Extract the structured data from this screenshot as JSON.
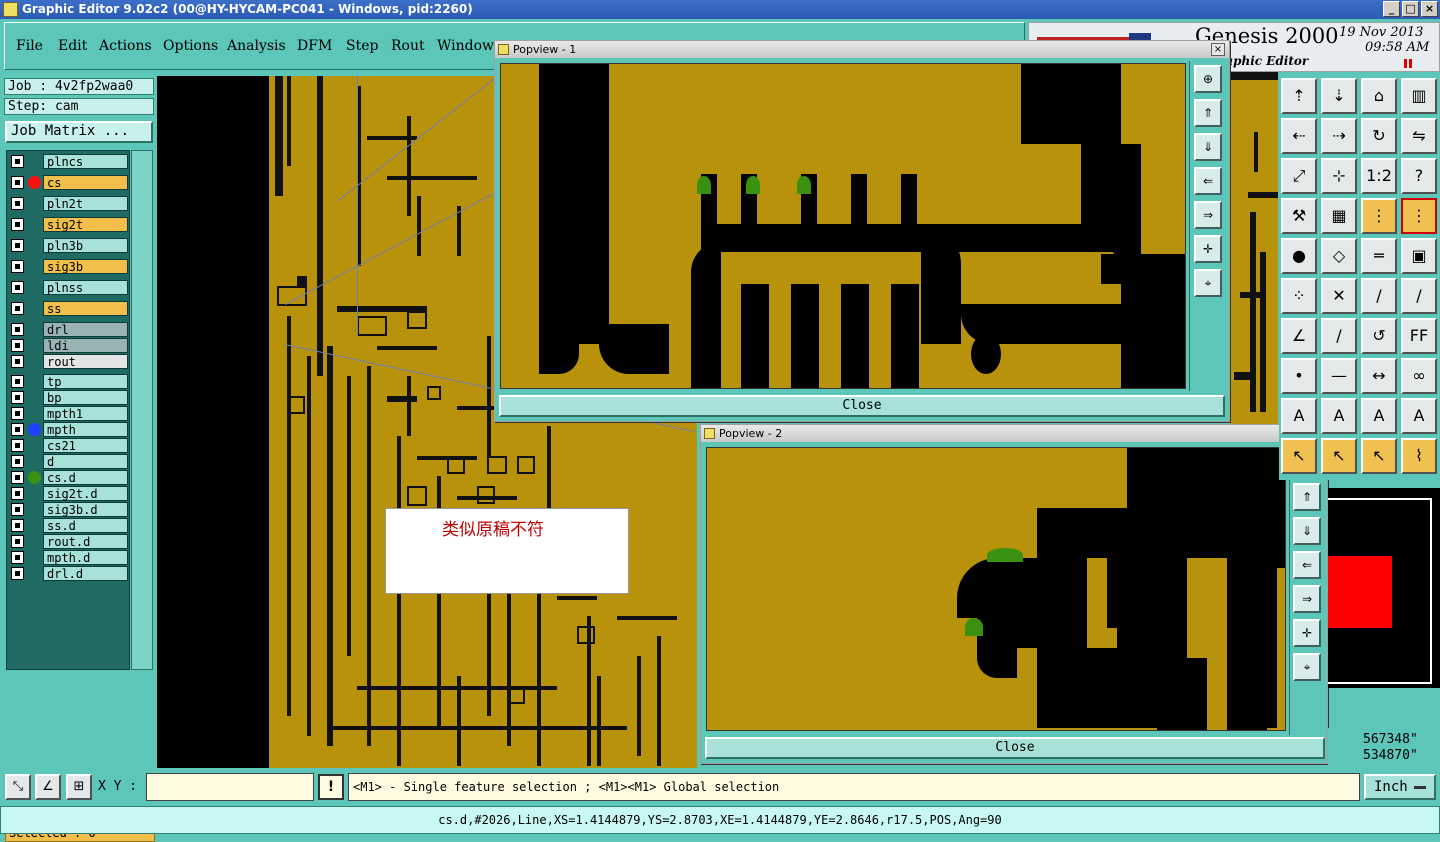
{
  "window": {
    "title": "Graphic Editor 9.02c2 (00@HY-HYCAM-PC041 - Windows, pid:2260)"
  },
  "menu": [
    {
      "label": "File"
    },
    {
      "label": "Edit"
    },
    {
      "label": "Actions"
    },
    {
      "label": "Options"
    },
    {
      "label": "Analysis"
    },
    {
      "label": "DFM"
    },
    {
      "label": "Step"
    },
    {
      "label": "Rout"
    },
    {
      "label": "Windows"
    }
  ],
  "brand": {
    "title": "Genesis 2000",
    "subtitle": "raphic Editor",
    "date": "19 Nov 2013",
    "time": "09:58 AM"
  },
  "job": {
    "job_line": "Job : 4v2fp2waa0",
    "step_line": "Step: cam",
    "job_matrix_label": "Job Matrix ..."
  },
  "layers": [
    {
      "name": "plncs",
      "bg": "#a8e0da",
      "dot": ""
    },
    {
      "name": "cs",
      "bg": "#f2bf4a",
      "dot": "#ff1010"
    },
    {
      "name": "pln2t",
      "bg": "#a8e0da",
      "dot": ""
    },
    {
      "name": "sig2t",
      "bg": "#f2bf4a",
      "dot": ""
    },
    {
      "name": "pln3b",
      "bg": "#a8e0da",
      "dot": ""
    },
    {
      "name": "sig3b",
      "bg": "#f2bf4a",
      "dot": ""
    },
    {
      "name": "plnss",
      "bg": "#a8e0da",
      "dot": ""
    },
    {
      "name": "ss",
      "bg": "#f2bf4a",
      "dot": ""
    },
    {
      "name": "drl",
      "bg": "#9ab4b4",
      "dot": ""
    },
    {
      "name": "ldi",
      "bg": "#9ab4b4",
      "dot": ""
    },
    {
      "name": "rout",
      "bg": "#e4e4e4",
      "dot": ""
    },
    {
      "name": "tp",
      "bg": "#a8e0da",
      "dot": ""
    },
    {
      "name": "bp",
      "bg": "#a8e0da",
      "dot": ""
    },
    {
      "name": "mpth1",
      "bg": "#a8e0da",
      "dot": ""
    },
    {
      "name": "mpth",
      "bg": "#a8e0da",
      "dot": "#2040ff"
    },
    {
      "name": "cs21",
      "bg": "#a8e0da",
      "dot": ""
    },
    {
      "name": "d",
      "bg": "#a8e0da",
      "dot": ""
    },
    {
      "name": "cs.d",
      "bg": "#a8e0da",
      "dot": "#3a9010"
    },
    {
      "name": "sig2t.d",
      "bg": "#a8e0da",
      "dot": ""
    },
    {
      "name": "sig3b.d",
      "bg": "#a8e0da",
      "dot": ""
    },
    {
      "name": "ss.d",
      "bg": "#a8e0da",
      "dot": ""
    },
    {
      "name": "rout.d",
      "bg": "#a8e0da",
      "dot": ""
    },
    {
      "name": "mpth.d",
      "bg": "#a8e0da",
      "dot": ""
    },
    {
      "name": "drl.d",
      "bg": "#a8e0da",
      "dot": ""
    }
  ],
  "selected_label": "Selected : 0",
  "note_text": "类似原稿不符",
  "popup1": {
    "title": "Popview - 1",
    "close_label": "Close"
  },
  "popup2": {
    "title": "Popview - 2",
    "close_label": "Close"
  },
  "coords": {
    "x": "567348\"",
    "y": "534870\""
  },
  "bottom": {
    "xy_label": "X Y :",
    "xy_value": "",
    "message": "<M1> - Single feature selection ; <M1><M1> Global selection",
    "unit": "Inch"
  },
  "status": "cs.d,#2026,Line,XS=1.4144879,YS=2.8703,XE=1.4144879,YE=2.8646,r17.5,POS,Ang=90",
  "tool_icons": [
    "open-step-icon",
    "save-icon",
    "home-icon",
    "window-split-icon",
    "pan-left-icon",
    "pan-right-icon",
    "rotate-icon",
    "mirror-icon",
    "fit-icon",
    "center-icon",
    "scale-icon",
    "help-icon",
    "tools-icon",
    "grid-icon",
    "layers-icon",
    "layers-red-icon",
    "feature-icon",
    "shape-icon",
    "ruler-icon",
    "snap-icon",
    "net-icon",
    "cross-icon",
    "line-icon",
    "line2-icon",
    "angle-icon",
    "slash-icon",
    "arc-icon",
    "text-icon",
    "point-icon",
    "bar-icon",
    "measure-icon",
    "cluster-icon",
    "triangle-icon",
    "arch-icon",
    "arch2-icon",
    "arch3-icon",
    "cursor-icon",
    "cursor2-icon",
    "cursor3-icon",
    "network-icon"
  ]
}
